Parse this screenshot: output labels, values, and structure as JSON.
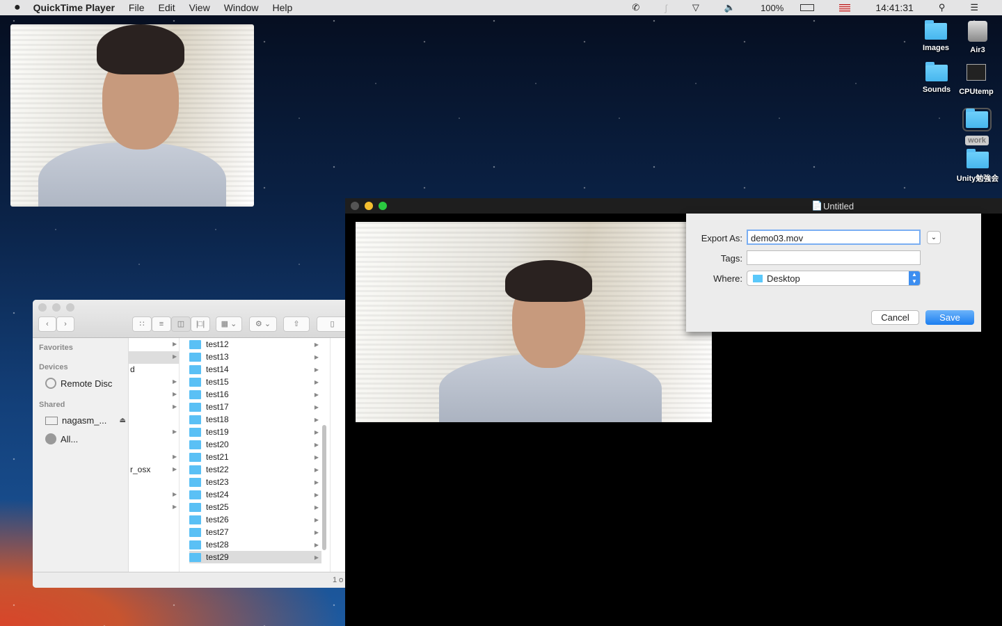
{
  "menubar": {
    "apple": "",
    "app": "QuickTime Player",
    "items": [
      "File",
      "Edit",
      "View",
      "Window",
      "Help"
    ],
    "battery": "100%",
    "clock": "14:41:31"
  },
  "desktop": {
    "icons": [
      "Images",
      "Air3",
      "Sounds",
      "CPUtemp",
      "work",
      "Unity勉強会"
    ]
  },
  "finder": {
    "sidebar": {
      "favorites": "Favorites",
      "devices": "Devices",
      "remote_disc": "Remote Disc",
      "shared": "Shared",
      "host": "nagasm_...",
      "all": "All..."
    },
    "col1": [
      "d",
      "r_osx"
    ],
    "rows": [
      "test12",
      "test13",
      "test14",
      "test15",
      "test16",
      "test17",
      "test18",
      "test19",
      "test20",
      "test21",
      "test22",
      "test23",
      "test24",
      "test25",
      "test26",
      "test27",
      "test28",
      "test29"
    ],
    "status": "1 o"
  },
  "quicktime": {
    "title": "Untitled"
  },
  "export": {
    "export_label": "Export As:",
    "filename": "demo03.mov",
    "tags_label": "Tags:",
    "tags": "",
    "where_label": "Where:",
    "where": "Desktop",
    "cancel": "Cancel",
    "save": "Save"
  },
  "colors": {
    "accent": "#3d8ef0",
    "folder": "#5ac8fa"
  }
}
